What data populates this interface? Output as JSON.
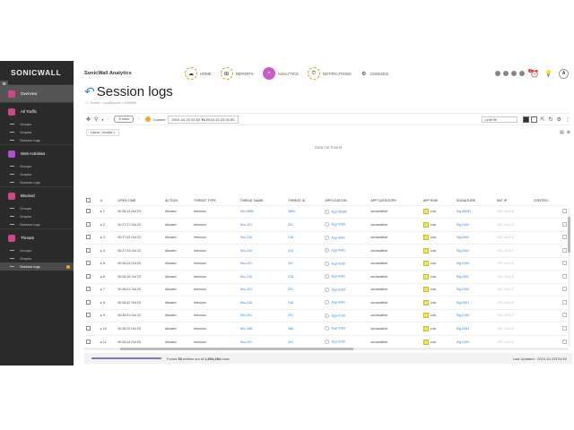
{
  "sidebar": {
    "logo": "SONICWALL",
    "menu_icon": "≡",
    "sections": [
      {
        "label": "Overview",
        "color": "#d0468c",
        "active": true,
        "items": []
      },
      {
        "label": "All Traffic",
        "color": "#d0468c",
        "items": [
          "Groups",
          "Graphs",
          "Session logs"
        ]
      },
      {
        "label": "Web Activities",
        "color": "#b04fd0",
        "items": [
          "Groups",
          "Graphs",
          "Session logs"
        ]
      },
      {
        "label": "Blocked",
        "color": "#d0468c",
        "items": [
          "Groups",
          "Graphs",
          "Session logs"
        ]
      },
      {
        "label": "Threats",
        "color": "#d0468c",
        "items": [
          "Groups",
          "Graphs",
          "Session logs"
        ],
        "active_item": 2
      }
    ]
  },
  "header": {
    "brand": "SonicWall Analytics",
    "nav": [
      {
        "label": "HOME",
        "icon": "☁"
      },
      {
        "label": "REPORTS",
        "icon": "⊞"
      },
      {
        "label": "ANALYTICS",
        "icon": "◔",
        "active": true
      },
      {
        "label": "NOTIFICATIONS",
        "icon": "⏱"
      },
      {
        "label": "CONSOLE",
        "icon": "⚙"
      }
    ],
    "user_initial": "A",
    "notif_count": "2"
  },
  "page": {
    "title": "Session logs",
    "breadcrumb": "/ Tenant · LocalDomain / GW9800"
  },
  "toolbar": {
    "preset": "5 mins",
    "custom_label": "Custom",
    "date_from": "2019-10-22 01:52",
    "to_label": "To",
    "date_to": "2019-10-23 01:52",
    "limit": "Limit 50"
  },
  "filter": {
    "chip": "Users : Invalid ×"
  },
  "no_data": "Data not Found",
  "table": {
    "headers": [
      "",
      "#",
      "OPEN TIME",
      "ACTION",
      "THREAT TYPE",
      "THREAT NAME",
      "THREAT ID",
      "APPLICATION",
      "APP CATEGORY",
      "APP RISK",
      "SIGNATURE",
      "INIT IP",
      "CONTRO..."
    ],
    "rows": [
      [
        "1",
        "00:28:13 Oct 23",
        "Allowed",
        "Intrusion",
        "Sec-9880",
        "9880",
        "App-58380",
        "unclassified",
        "Low",
        "Sig-58381",
        "192.16.8.8"
      ],
      [
        "2",
        "00:27:47 Oct 23",
        "Allowed",
        "Intrusion",
        "Sec-201",
        "201",
        "App-0283",
        "unclassified",
        "Low",
        "Sig-0283",
        "192.16.8.8"
      ],
      [
        "3",
        "00:27:43 Oct 23",
        "Allowed",
        "Intrusion",
        "Sec-216",
        "216",
        "App-0081",
        "unclassified",
        "Low",
        "Sig-0081",
        "192.16.8.8"
      ],
      [
        "4",
        "00:27:34 Oct 23",
        "Allowed",
        "Intrusion",
        "Sec-216",
        "216",
        "App-0081",
        "unclassified",
        "Low",
        "Sig-0081",
        "192.16.8.8"
      ],
      [
        "5",
        "00:26:24 Oct 23",
        "Allowed",
        "Intrusion",
        "Sec-201",
        "201",
        "App-0190",
        "unclassified",
        "Low",
        "Sig-0190",
        "192.16.8.8"
      ],
      [
        "6",
        "00:26:19 Oct 23",
        "Allowed",
        "Intrusion",
        "Sec-216",
        "216",
        "App-0081",
        "unclassified",
        "Low",
        "Sig-0081",
        "192.16.8.8"
      ],
      [
        "7",
        "00:26:01 Oct 23",
        "Allowed",
        "Intrusion",
        "Sec-201",
        "201",
        "App-0283",
        "unclassified",
        "Low",
        "Sig-0283",
        "192.16.8.8"
      ],
      [
        "8",
        "00:26:42 Oct 23",
        "Allowed",
        "Intrusion",
        "Sec-216",
        "216",
        "App-0081",
        "unclassified",
        "Low",
        "Sig-0081",
        "192.16.8.8"
      ],
      [
        "9",
        "00:26:41 Oct 23",
        "Allowed",
        "Intrusion",
        "Sec-201",
        "201",
        "App-0190",
        "unclassified",
        "Low",
        "Sig-0190",
        "192.16.8.8"
      ],
      [
        "10",
        "00:26:22 Oct 23",
        "Allowed",
        "Intrusion",
        "Sec-388",
        "388",
        "App-0283",
        "unclassified",
        "Low",
        "Sig-0283",
        "192.16.8.8"
      ],
      [
        "11",
        "00:26:24 Oct 23",
        "Allowed",
        "Intrusion",
        "Sec-201",
        "201",
        "App-0190",
        "unclassified",
        "Low",
        "Sig-0190",
        "192.16.8.8"
      ]
    ]
  },
  "footer": {
    "found_prefix": "Found",
    "found_count": "50",
    "found_mid": "entries out of",
    "total": "1,694,284",
    "found_suffix": "rows",
    "updated": "Last Updated : 2019-10-23T01:52"
  }
}
